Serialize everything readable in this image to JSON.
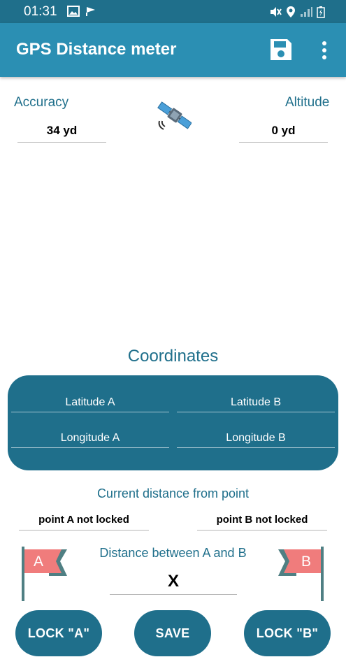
{
  "status_bar": {
    "time": "01:31",
    "left_icons": [
      "image-icon",
      "flag-icon"
    ],
    "right_icons": [
      "mute-icon",
      "location-icon",
      "signal-icon",
      "battery-icon"
    ]
  },
  "app_bar": {
    "title": "GPS Distance meter",
    "actions": [
      "save-icon",
      "more-vertical-icon"
    ]
  },
  "accuracy": {
    "label": "Accuracy",
    "value": "34 yd"
  },
  "altitude": {
    "label": "Altitude",
    "value": "0 yd"
  },
  "satellite_icon": "satellite-icon",
  "coordinates": {
    "title": "Coordinates",
    "latitude_a": "Latitude A",
    "latitude_b": "Latitude B",
    "longitude_a": "Longitude A",
    "longitude_b": "Longitude B"
  },
  "current_distance": {
    "label": "Current distance from point",
    "point_a": "point A not locked",
    "point_b": "point B not locked"
  },
  "distance_between": {
    "label": "Distance between A and B",
    "value": "X"
  },
  "flags": {
    "a": "A",
    "b": "B"
  },
  "buttons": {
    "lock_a": "LOCK \"A\"",
    "save": "SAVE",
    "lock_b": "LOCK \"B\""
  },
  "colors": {
    "primary_dark": "#1f6f8b",
    "app_bar": "#2b8fb3",
    "flag": "#f07c7c"
  }
}
